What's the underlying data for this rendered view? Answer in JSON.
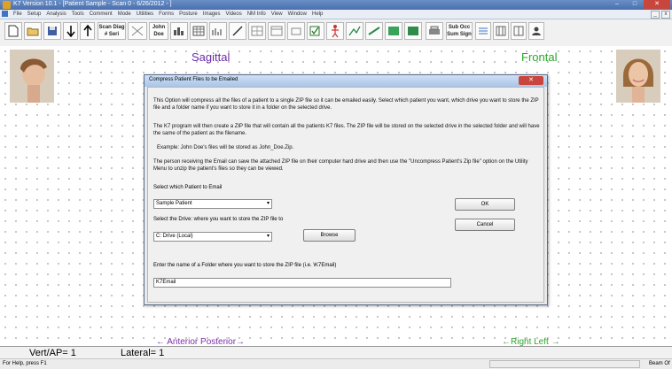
{
  "window": {
    "title": "K7 Version 10.1 - [Patient Sample - Scan 0 - 6/26/2012 - ]",
    "min": "–",
    "max": "□",
    "close": "✕"
  },
  "menu": [
    "File",
    "Setup",
    "Analysis",
    "Tools",
    "Comment",
    "Mode",
    "Utilities",
    "Forms",
    "Posture",
    "Images",
    "Videos",
    "NM Info",
    "View",
    "Window",
    "Help"
  ],
  "mdi": {
    "min": "_",
    "close": "x"
  },
  "toolbar": {
    "scan_seri": "Scan Diag\n# Seri",
    "john_doe": "John\nDoe",
    "sub_occ": "Sub Occ\nSum Sign"
  },
  "views": {
    "sagittal": "Sagittal",
    "frontal": "Frontal"
  },
  "axes": {
    "anterior": "← Anterior  Posterior→",
    "rightleft": "←Right  Left →"
  },
  "measures": {
    "vert": "Vert/AP= 1",
    "lateral": "Lateral= 1"
  },
  "status": {
    "help": "For Help, press F1",
    "beam": "Beam Of"
  },
  "dialog": {
    "title": "Compress Patient Files to be Emailed",
    "para1": "This Option will compress all the files of a patient to a single ZIP file so it can be emailed easily.  Select which patient you want, which drive you want to store the ZIP file and a folder name if you want to store it in a folder on the selected drive.",
    "para2": "The K7 program will then create a ZIP file that will contain all the patients K7 files.  The ZIP file will be stored on the selected drive in the selected folder and will have the same of the patient as the filename.",
    "para3": "Example:  John Doe's files will be stored as John_Doe.Zip.",
    "para4": "The person receiving the Email can save the attached ZIP file on their computer hard drive and then use the \"Uncompress Patient's Zip file\" option on the Utility Menu to unzip the patient's files so they can be viewed.",
    "patient_label": "Select which Patient to Email",
    "patient_value": "Sample Patient",
    "drive_label": "Select the Drive: where you want to store the ZIP file to",
    "drive_value": "C:  Drive  (Local)",
    "browse": "Browse",
    "ok": "OK",
    "cancel": "Cancel",
    "folder_label": "Enter the name of a Folder where you want to store the ZIP file (i.e. \\K7Email)",
    "folder_value": "K7Email",
    "dropdown_arrow": "▾"
  }
}
